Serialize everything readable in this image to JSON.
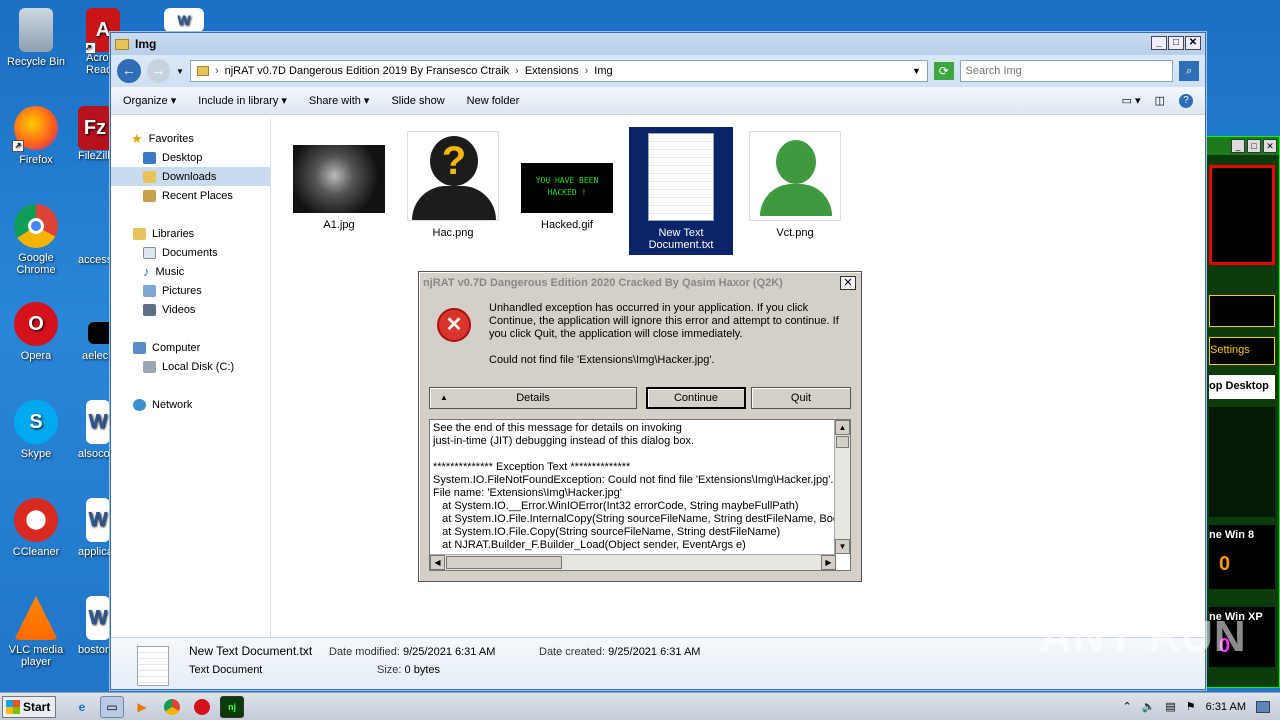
{
  "desktop": {
    "icons": [
      {
        "label": "Recycle Bin"
      },
      {
        "label": "Acrobat Reader"
      },
      {
        "label": "Firefox"
      },
      {
        "label": "FileZilla"
      },
      {
        "label": "Google Chrome"
      },
      {
        "label": "access"
      },
      {
        "label": "Opera"
      },
      {
        "label": "aelect"
      },
      {
        "label": "Skype"
      },
      {
        "label": "alsoco"
      },
      {
        "label": "CCleaner"
      },
      {
        "label": "applica"
      },
      {
        "label": "VLC media player"
      },
      {
        "label": "boston"
      }
    ],
    "watermark": "ANY RUN"
  },
  "bg_window": {
    "settings_label": "Settings",
    "desktop_label": "op Desktop",
    "win8_label": "ne Win  8",
    "win8_count": "0",
    "winxp_label": "ne Win  XP",
    "winxp_count": "0"
  },
  "explorer": {
    "title": "Img",
    "breadcrumb": [
      "njRAT v0.7D Dangerous Edition 2019 By Fransesco Ctraik",
      "Extensions",
      "Img"
    ],
    "search_placeholder": "Search Img",
    "commands": [
      "Organize",
      "Include in library",
      "Share with",
      "Slide show",
      "New folder"
    ],
    "nav": {
      "favorites": "Favorites",
      "desktop": "Desktop",
      "downloads": "Downloads",
      "recent": "Recent Places",
      "libraries": "Libraries",
      "documents": "Documents",
      "music": "Music",
      "pictures": "Pictures",
      "videos": "Videos",
      "computer": "Computer",
      "local_disk": "Local Disk (C:)",
      "network": "Network"
    },
    "files": [
      {
        "name": "A1.jpg"
      },
      {
        "name": "Hac.png"
      },
      {
        "name": "Hacked.gif",
        "overlay": "YOU HAVE BEEN HACKED !"
      },
      {
        "name": "New Text Document.txt"
      },
      {
        "name": "Vct.png"
      }
    ],
    "details": {
      "name": "New Text Document.txt",
      "type": "Text Document",
      "modified_label": "Date modified:",
      "modified": "9/25/2021 6:31 AM",
      "created_label": "Date created:",
      "created": "9/25/2021 6:31 AM",
      "size_label": "Size:",
      "size": "0 bytes"
    }
  },
  "dialog": {
    "title": "njRAT v0.7D Dangerous Edition 2020 Cracked By Qasim Haxor (Q2K)",
    "message": "Unhandled exception has occurred in your application. If you click Continue, the application will ignore this error and attempt to continue. If you click Quit, the application will close immediately.",
    "detail_message": "Could not find file 'Extensions\\Img\\Hacker.jpg'.",
    "details_button": "Details",
    "continue_button": "Continue",
    "quit_button": "Quit",
    "trace": "See the end of this message for details on invoking\njust-in-time (JIT) debugging instead of this dialog box.\n\n************** Exception Text **************\nSystem.IO.FileNotFoundException: Could not find file 'Extensions\\Img\\Hacker.jpg'.\nFile name: 'Extensions\\Img\\Hacker.jpg'\n   at System.IO.__Error.WinIOError(Int32 errorCode, String maybeFullPath)\n   at System.IO.File.InternalCopy(String sourceFileName, String destFileName, Boolean\n   at System.IO.File.Copy(String sourceFileName, String destFileName)\n   at NJRAT.Builder_F.Builder_Load(Object sender, EventArgs e)"
  },
  "taskbar": {
    "start_label": "Start",
    "clock": "6:31 AM"
  }
}
